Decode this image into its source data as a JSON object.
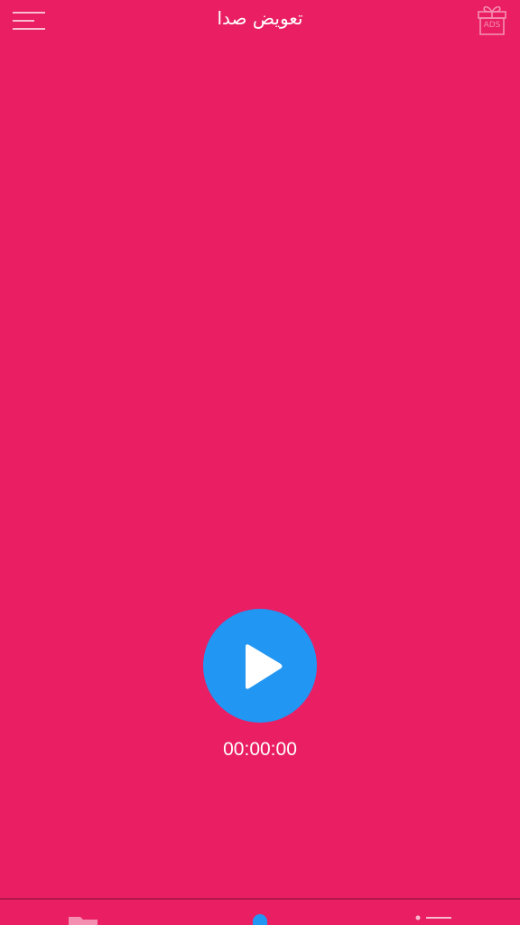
{
  "header": {
    "title": "تعويض صدا",
    "menu_icon": "menu-icon",
    "ads_icon": "gift-ads-icon",
    "ads_label": "ADS"
  },
  "player": {
    "timer": "00:00:00",
    "play_icon": "play-icon",
    "waveform_state": "flat"
  },
  "bottom_nav": {
    "items": [
      {
        "icon": "folder-icon"
      },
      {
        "icon": "microphone-icon"
      },
      {
        "icon": "settings-list-icon"
      }
    ]
  },
  "colors": {
    "background": "#E91E63",
    "accent": "#2196F3",
    "text": "#FFFFFF"
  }
}
